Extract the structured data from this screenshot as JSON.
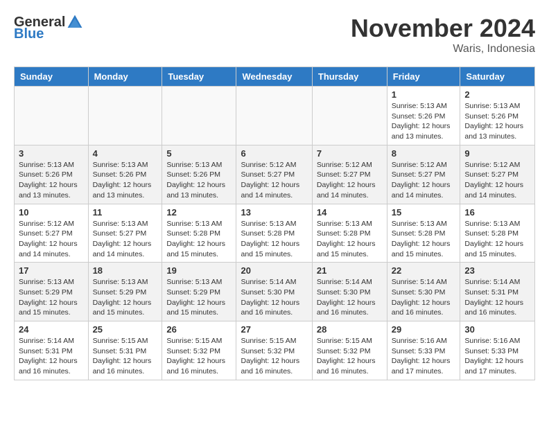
{
  "logo": {
    "general": "General",
    "blue": "Blue"
  },
  "title": "November 2024",
  "location": "Waris, Indonesia",
  "days_of_week": [
    "Sunday",
    "Monday",
    "Tuesday",
    "Wednesday",
    "Thursday",
    "Friday",
    "Saturday"
  ],
  "weeks": [
    [
      {
        "day": "",
        "info": ""
      },
      {
        "day": "",
        "info": ""
      },
      {
        "day": "",
        "info": ""
      },
      {
        "day": "",
        "info": ""
      },
      {
        "day": "",
        "info": ""
      },
      {
        "day": "1",
        "info": "Sunrise: 5:13 AM\nSunset: 5:26 PM\nDaylight: 12 hours\nand 13 minutes."
      },
      {
        "day": "2",
        "info": "Sunrise: 5:13 AM\nSunset: 5:26 PM\nDaylight: 12 hours\nand 13 minutes."
      }
    ],
    [
      {
        "day": "3",
        "info": "Sunrise: 5:13 AM\nSunset: 5:26 PM\nDaylight: 12 hours\nand 13 minutes."
      },
      {
        "day": "4",
        "info": "Sunrise: 5:13 AM\nSunset: 5:26 PM\nDaylight: 12 hours\nand 13 minutes."
      },
      {
        "day": "5",
        "info": "Sunrise: 5:13 AM\nSunset: 5:26 PM\nDaylight: 12 hours\nand 13 minutes."
      },
      {
        "day": "6",
        "info": "Sunrise: 5:12 AM\nSunset: 5:27 PM\nDaylight: 12 hours\nand 14 minutes."
      },
      {
        "day": "7",
        "info": "Sunrise: 5:12 AM\nSunset: 5:27 PM\nDaylight: 12 hours\nand 14 minutes."
      },
      {
        "day": "8",
        "info": "Sunrise: 5:12 AM\nSunset: 5:27 PM\nDaylight: 12 hours\nand 14 minutes."
      },
      {
        "day": "9",
        "info": "Sunrise: 5:12 AM\nSunset: 5:27 PM\nDaylight: 12 hours\nand 14 minutes."
      }
    ],
    [
      {
        "day": "10",
        "info": "Sunrise: 5:12 AM\nSunset: 5:27 PM\nDaylight: 12 hours\nand 14 minutes."
      },
      {
        "day": "11",
        "info": "Sunrise: 5:13 AM\nSunset: 5:27 PM\nDaylight: 12 hours\nand 14 minutes."
      },
      {
        "day": "12",
        "info": "Sunrise: 5:13 AM\nSunset: 5:28 PM\nDaylight: 12 hours\nand 15 minutes."
      },
      {
        "day": "13",
        "info": "Sunrise: 5:13 AM\nSunset: 5:28 PM\nDaylight: 12 hours\nand 15 minutes."
      },
      {
        "day": "14",
        "info": "Sunrise: 5:13 AM\nSunset: 5:28 PM\nDaylight: 12 hours\nand 15 minutes."
      },
      {
        "day": "15",
        "info": "Sunrise: 5:13 AM\nSunset: 5:28 PM\nDaylight: 12 hours\nand 15 minutes."
      },
      {
        "day": "16",
        "info": "Sunrise: 5:13 AM\nSunset: 5:28 PM\nDaylight: 12 hours\nand 15 minutes."
      }
    ],
    [
      {
        "day": "17",
        "info": "Sunrise: 5:13 AM\nSunset: 5:29 PM\nDaylight: 12 hours\nand 15 minutes."
      },
      {
        "day": "18",
        "info": "Sunrise: 5:13 AM\nSunset: 5:29 PM\nDaylight: 12 hours\nand 15 minutes."
      },
      {
        "day": "19",
        "info": "Sunrise: 5:13 AM\nSunset: 5:29 PM\nDaylight: 12 hours\nand 15 minutes."
      },
      {
        "day": "20",
        "info": "Sunrise: 5:14 AM\nSunset: 5:30 PM\nDaylight: 12 hours\nand 16 minutes."
      },
      {
        "day": "21",
        "info": "Sunrise: 5:14 AM\nSunset: 5:30 PM\nDaylight: 12 hours\nand 16 minutes."
      },
      {
        "day": "22",
        "info": "Sunrise: 5:14 AM\nSunset: 5:30 PM\nDaylight: 12 hours\nand 16 minutes."
      },
      {
        "day": "23",
        "info": "Sunrise: 5:14 AM\nSunset: 5:31 PM\nDaylight: 12 hours\nand 16 minutes."
      }
    ],
    [
      {
        "day": "24",
        "info": "Sunrise: 5:14 AM\nSunset: 5:31 PM\nDaylight: 12 hours\nand 16 minutes."
      },
      {
        "day": "25",
        "info": "Sunrise: 5:15 AM\nSunset: 5:31 PM\nDaylight: 12 hours\nand 16 minutes."
      },
      {
        "day": "26",
        "info": "Sunrise: 5:15 AM\nSunset: 5:32 PM\nDaylight: 12 hours\nand 16 minutes."
      },
      {
        "day": "27",
        "info": "Sunrise: 5:15 AM\nSunset: 5:32 PM\nDaylight: 12 hours\nand 16 minutes."
      },
      {
        "day": "28",
        "info": "Sunrise: 5:15 AM\nSunset: 5:32 PM\nDaylight: 12 hours\nand 16 minutes."
      },
      {
        "day": "29",
        "info": "Sunrise: 5:16 AM\nSunset: 5:33 PM\nDaylight: 12 hours\nand 17 minutes."
      },
      {
        "day": "30",
        "info": "Sunrise: 5:16 AM\nSunset: 5:33 PM\nDaylight: 12 hours\nand 17 minutes."
      }
    ]
  ]
}
